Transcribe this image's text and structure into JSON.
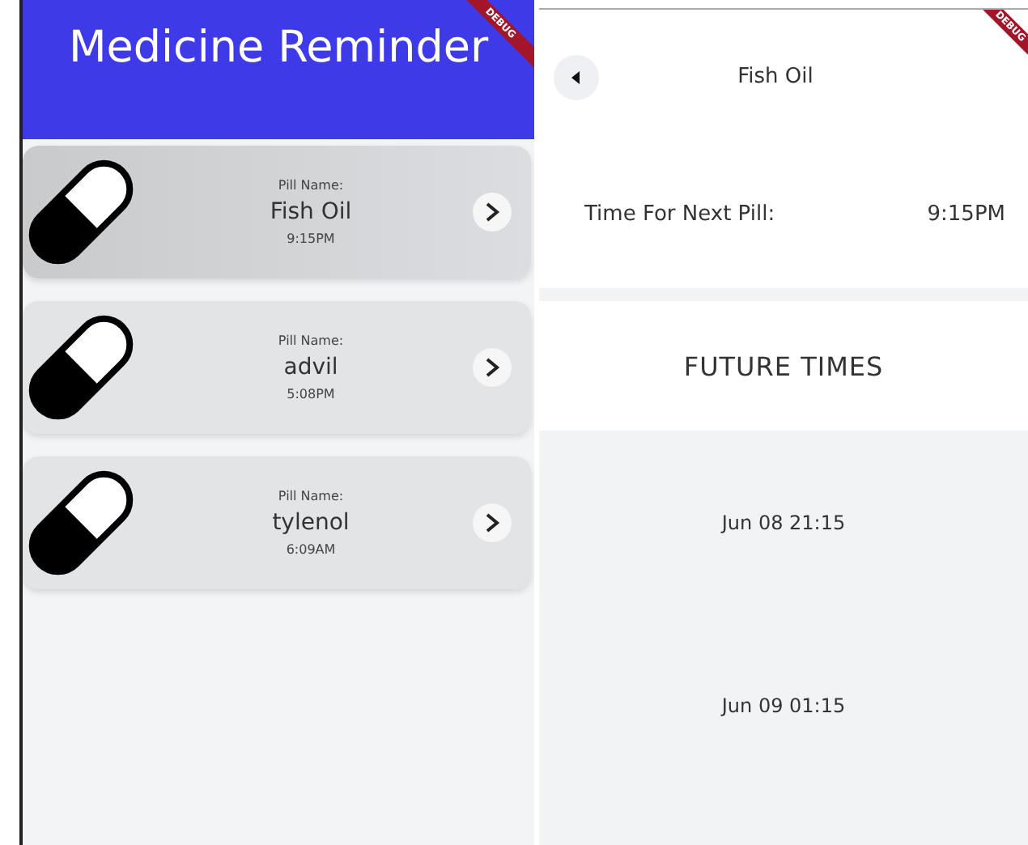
{
  "list_screen": {
    "app_bar": {
      "title": "Medicine Reminder",
      "debug_banner": "DEBUG"
    },
    "pills": [
      {
        "label": "Pill Name:",
        "name": "Fish Oil",
        "time": "9:15PM",
        "highlighted": true
      },
      {
        "label": "Pill Name:",
        "name": "advil",
        "time": "5:08PM",
        "highlighted": false
      },
      {
        "label": "Pill Name:",
        "name": "tylenol",
        "time": "6:09AM",
        "highlighted": false
      }
    ]
  },
  "detail_screen": {
    "title": "Fish Oil",
    "debug_banner": "DEBUG",
    "next_pill": {
      "label": "Time For Next Pill:",
      "value": "9:15PM"
    },
    "future_heading": "FUTURE TIMES",
    "future_times": [
      "Jun 08 21:15",
      "Jun 09 01:15"
    ]
  }
}
